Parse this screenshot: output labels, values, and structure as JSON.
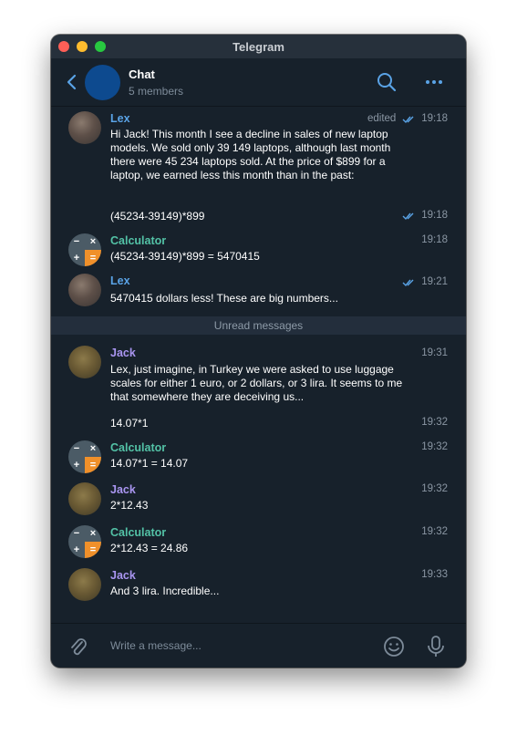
{
  "window": {
    "title": "Telegram"
  },
  "header": {
    "title": "Chat",
    "subtitle": "5 members"
  },
  "icons": {
    "back": "chevron-left-icon",
    "search": "search-icon",
    "more": "more-icon",
    "attach": "paperclip-icon",
    "emoji": "emoji-icon",
    "mic": "microphone-icon"
  },
  "colors": {
    "background": "#17212b",
    "lex_name": "#5aa3e6",
    "jack_name": "#a995f0",
    "calculator_name": "#53c2a6",
    "accent": "#5aa3e6",
    "calc_orange": "#f0902a"
  },
  "messages": [
    {
      "sender": "Lex",
      "edited": "edited",
      "time": "19:18",
      "text": "Hi Jack! This month I see a decline in sales of new laptop models. We sold only 39 149 laptops, although last month there were 45 234 laptops sold. At the price of $899 for a laptop, we earned less this month than in the past:"
    },
    {
      "text": "(45234-39149)*899",
      "time": "19:18"
    },
    {
      "sender": "Calculator",
      "time": "19:18",
      "text": "(45234-39149)*899 = 5470415"
    },
    {
      "sender": "Lex",
      "time": "19:21",
      "text": "5470415 dollars less! These are big numbers..."
    },
    {
      "sender": "Jack",
      "time": "19:31",
      "text": "Lex, just imagine, in Turkey we were asked to use luggage scales for either 1 euro, or 2 dollars, or 3 lira. It seems to me that somewhere they are deceiving us..."
    },
    {
      "text": "14.07*1",
      "time": "19:32"
    },
    {
      "sender": "Calculator",
      "time": "19:32",
      "text": "14.07*1 = 14.07"
    },
    {
      "sender": "Jack",
      "time": "19:32",
      "text": "2*12.43"
    },
    {
      "sender": "Calculator",
      "time": "19:32",
      "text": "2*12.43 = 24.86"
    },
    {
      "sender": "Jack",
      "time": "19:33",
      "text": "And 3 lira. Incredible..."
    }
  ],
  "unread_label": "Unread messages",
  "calculator_symbols": [
    "−",
    "×",
    "+",
    "="
  ],
  "composer": {
    "placeholder": "Write a message..."
  }
}
